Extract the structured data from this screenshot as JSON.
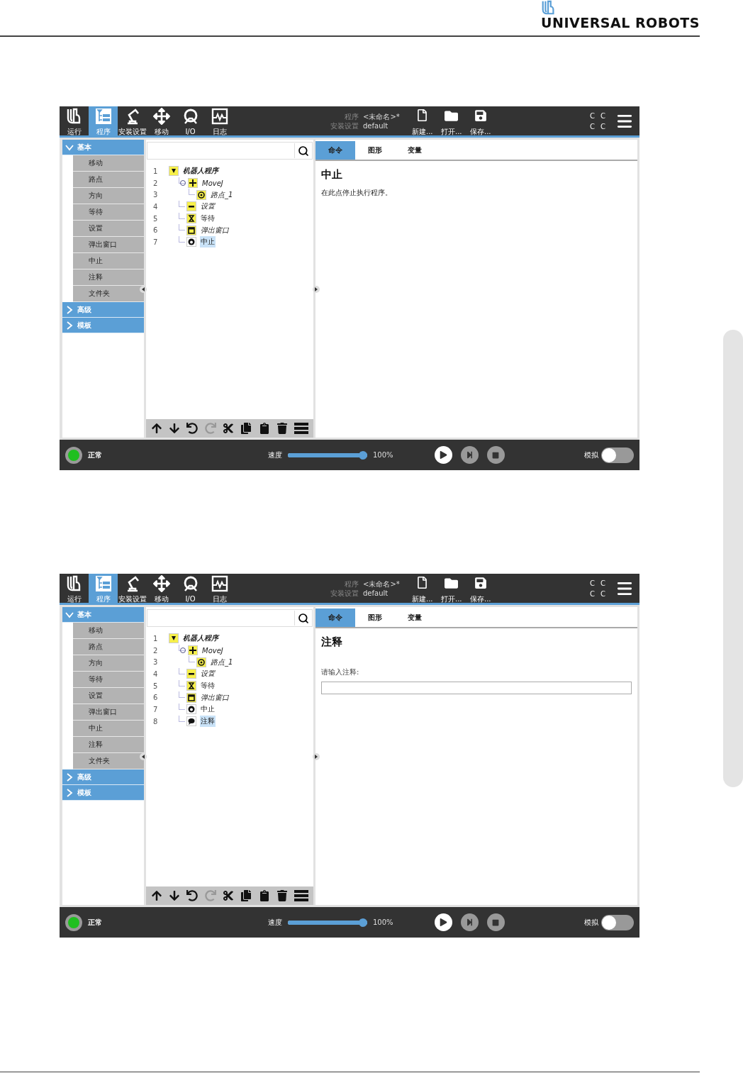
{
  "header": {
    "brand": "UNIVERSAL ROBOTS"
  },
  "screens": [
    {
      "nav": [
        {
          "kind": "run",
          "label": "运行",
          "selected": false
        },
        {
          "kind": "program",
          "label": "程序",
          "selected": true
        },
        {
          "kind": "installation",
          "label": "安装设置",
          "selected": false
        },
        {
          "kind": "move",
          "label": "移动",
          "selected": false
        },
        {
          "kind": "io",
          "label": "I/O",
          "selected": false
        },
        {
          "kind": "log",
          "label": "日志",
          "selected": false
        }
      ],
      "program_info": {
        "program_label": "程序",
        "program_name": "<未命名>*",
        "installation_label": "安装设置",
        "installation_name": "default"
      },
      "file_buttons": [
        {
          "kind": "new",
          "label": "新建..."
        },
        {
          "kind": "open",
          "label": "打开..."
        },
        {
          "kind": "save",
          "label": "保存..."
        }
      ],
      "indicators": [
        "C",
        "C",
        "C",
        "C"
      ],
      "sidebar": [
        {
          "label": "基本",
          "expanded": true,
          "items": [
            "移动",
            "路点",
            "方向",
            "等待",
            "设置",
            "弹出窗口",
            "中止",
            "注释",
            "文件夹"
          ]
        },
        {
          "label": "高级",
          "expanded": false
        },
        {
          "label": "模板",
          "expanded": false
        }
      ],
      "tree": [
        {
          "number": "1",
          "label": "机器人程序",
          "kind": "program",
          "italic": true,
          "selected": false,
          "children": [
            {
              "number": "2",
              "label": "MoveJ",
              "kind": "move",
              "italic": true,
              "selected": false,
              "children": [
                {
                  "number": "3",
                  "label": "路点_1",
                  "kind": "waypoint",
                  "italic": true,
                  "selected": false
                }
              ]
            },
            {
              "number": "4",
              "label": "设置",
              "kind": "set",
              "italic": true,
              "selected": false
            },
            {
              "number": "5",
              "label": "等待",
              "kind": "wait",
              "italic": false,
              "selected": false
            },
            {
              "number": "6",
              "label": "弹出窗口",
              "kind": "popup",
              "italic": true,
              "selected": false
            },
            {
              "number": "7",
              "label": "中止",
              "kind": "halt",
              "italic": false,
              "selected": true
            }
          ]
        }
      ],
      "tree_toolbar": [
        {
          "kind": "up",
          "disabled": false
        },
        {
          "kind": "down",
          "disabled": false
        },
        {
          "kind": "undo",
          "disabled": false
        },
        {
          "kind": "redo",
          "disabled": true
        },
        {
          "kind": "cut",
          "disabled": false
        },
        {
          "kind": "copy",
          "disabled": false
        },
        {
          "kind": "paste",
          "disabled": false
        },
        {
          "kind": "delete",
          "disabled": false
        },
        {
          "kind": "suppress",
          "disabled": false
        }
      ],
      "tabs": [
        {
          "label": "命令",
          "selected": true
        },
        {
          "label": "图形",
          "selected": false
        },
        {
          "label": "变量",
          "selected": false
        }
      ],
      "command": {
        "kind": "description",
        "title": "中止",
        "text": "在此点停止执行程序。"
      },
      "status_bar": {
        "status": "正常",
        "speed_label": "速度",
        "level": 1,
        "speed_reading": "100%",
        "controls": [
          {
            "kind": "play",
            "disabled": false
          },
          {
            "kind": "step",
            "disabled": true
          },
          {
            "kind": "stop",
            "disabled": true
          }
        ],
        "simulation_label": "模拟",
        "on": false
      }
    },
    {
      "nav": [
        {
          "kind": "run",
          "label": "运行",
          "selected": false
        },
        {
          "kind": "program",
          "label": "程序",
          "selected": true
        },
        {
          "kind": "installation",
          "label": "安装设置",
          "selected": false
        },
        {
          "kind": "move",
          "label": "移动",
          "selected": false
        },
        {
          "kind": "io",
          "label": "I/O",
          "selected": false
        },
        {
          "kind": "log",
          "label": "日志",
          "selected": false
        }
      ],
      "program_info": {
        "program_label": "程序",
        "program_name": "<未命名>*",
        "installation_label": "安装设置",
        "installation_name": "default"
      },
      "file_buttons": [
        {
          "kind": "new",
          "label": "新建..."
        },
        {
          "kind": "open",
          "label": "打开..."
        },
        {
          "kind": "save",
          "label": "保存..."
        }
      ],
      "indicators": [
        "C",
        "C",
        "C",
        "C"
      ],
      "sidebar": [
        {
          "label": "基本",
          "expanded": true,
          "items": [
            "移动",
            "路点",
            "方向",
            "等待",
            "设置",
            "弹出窗口",
            "中止",
            "注释",
            "文件夹"
          ]
        },
        {
          "label": "高级",
          "expanded": false
        },
        {
          "label": "模板",
          "expanded": false
        }
      ],
      "tree": [
        {
          "number": "1",
          "label": "机器人程序",
          "kind": "program",
          "italic": true,
          "selected": false,
          "children": [
            {
              "number": "2",
              "label": "MoveJ",
              "kind": "move",
              "italic": true,
              "selected": false,
              "children": [
                {
                  "number": "3",
                  "label": "路点_1",
                  "kind": "waypoint",
                  "italic": true,
                  "selected": false
                }
              ]
            },
            {
              "number": "4",
              "label": "设置",
              "kind": "set",
              "italic": true,
              "selected": false
            },
            {
              "number": "5",
              "label": "等待",
              "kind": "wait",
              "italic": false,
              "selected": false
            },
            {
              "number": "6",
              "label": "弹出窗口",
              "kind": "popup",
              "italic": true,
              "selected": false
            },
            {
              "number": "7",
              "label": "中止",
              "kind": "halt",
              "italic": false,
              "selected": false
            },
            {
              "number": "8",
              "label": "注释",
              "kind": "comment",
              "italic": false,
              "selected": true
            }
          ]
        }
      ],
      "tree_toolbar": [
        {
          "kind": "up",
          "disabled": false
        },
        {
          "kind": "down",
          "disabled": false
        },
        {
          "kind": "undo",
          "disabled": false
        },
        {
          "kind": "redo",
          "disabled": true
        },
        {
          "kind": "cut",
          "disabled": false
        },
        {
          "kind": "copy",
          "disabled": false
        },
        {
          "kind": "paste",
          "disabled": false
        },
        {
          "kind": "delete",
          "disabled": false
        },
        {
          "kind": "suppress",
          "disabled": false
        }
      ],
      "tabs": [
        {
          "label": "命令",
          "selected": true
        },
        {
          "label": "图形",
          "selected": false
        },
        {
          "label": "变量",
          "selected": false
        }
      ],
      "command": {
        "kind": "input",
        "title": "注释",
        "field_label": "请输入注释:"
      },
      "status_bar": {
        "status": "正常",
        "speed_label": "速度",
        "level": 1,
        "speed_reading": "100%",
        "controls": [
          {
            "kind": "play",
            "disabled": false
          },
          {
            "kind": "step",
            "disabled": true
          },
          {
            "kind": "stop",
            "disabled": true
          }
        ],
        "simulation_label": "模拟",
        "on": false
      }
    }
  ]
}
